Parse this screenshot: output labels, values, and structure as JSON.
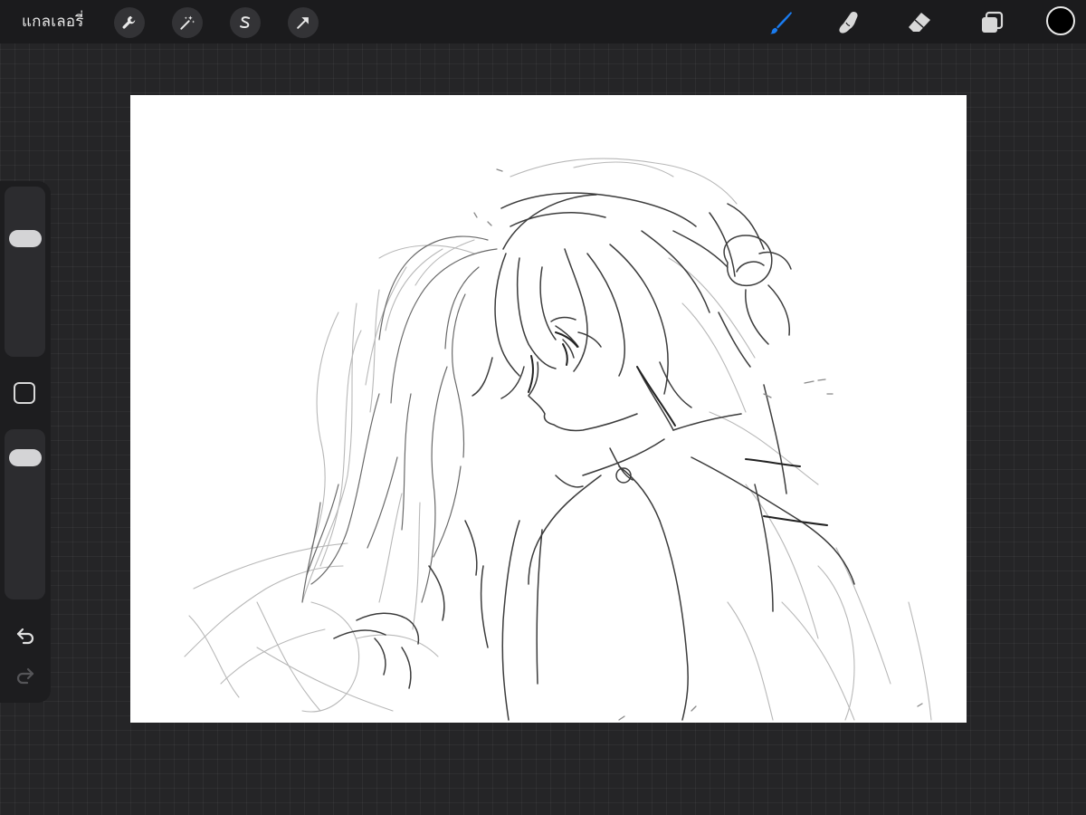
{
  "toolbar": {
    "gallery_label": "แกลเลอรี่",
    "actions_icon": "wrench-icon",
    "adjustments_icon": "magic-wand-icon",
    "selection_icon": "selection-s-icon",
    "transform_icon": "arrow-cursor-icon",
    "brush_icon": "brush-icon",
    "smudge_icon": "smudge-finger-icon",
    "eraser_icon": "eraser-icon",
    "layers_icon": "layers-icon",
    "active_tool": "brush"
  },
  "colors": {
    "active_tool": "#1a7cf0",
    "current_color": "#000000",
    "canvas_background": "#ffffff",
    "app_background": "#252527"
  },
  "sidebar": {
    "brush_size_level": 0.73,
    "opacity_level": 0.9,
    "undo_icon": "undo-icon",
    "redo_icon": "redo-icon",
    "redo_enabled": false
  }
}
